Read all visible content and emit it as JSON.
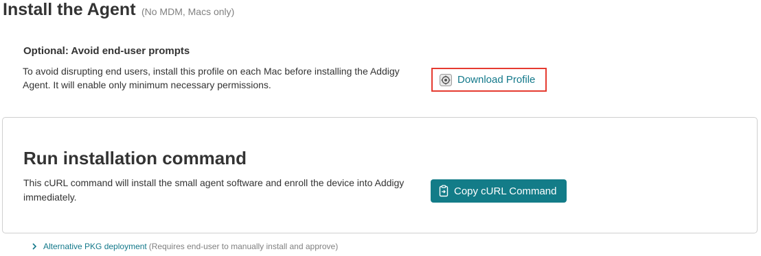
{
  "header": {
    "title": "Install the Agent",
    "note": "(No MDM, Macs only)"
  },
  "optional_section": {
    "heading": "Optional: Avoid end-user prompts",
    "description": "To avoid disrupting end users, install this profile on each Mac before installing the Addigy Agent. It will enable only minimum necessary permissions.",
    "button_label": "Download Profile",
    "button_icon": "gear-icon"
  },
  "command_section": {
    "title": "Run installation command",
    "description": "This cURL command will install the small agent software and enroll the device into Addigy immediately.",
    "button_label": "Copy cURL Command",
    "button_icon": "clipboard-icon"
  },
  "alternative": {
    "link_label": "Alternative PKG deployment",
    "note": "(Requires end-user to manually install and approve)",
    "icon": "chevron-right-icon"
  },
  "colors": {
    "accent": "#12788a",
    "button_bg": "#137c88",
    "highlight_border": "#e53a2f"
  }
}
